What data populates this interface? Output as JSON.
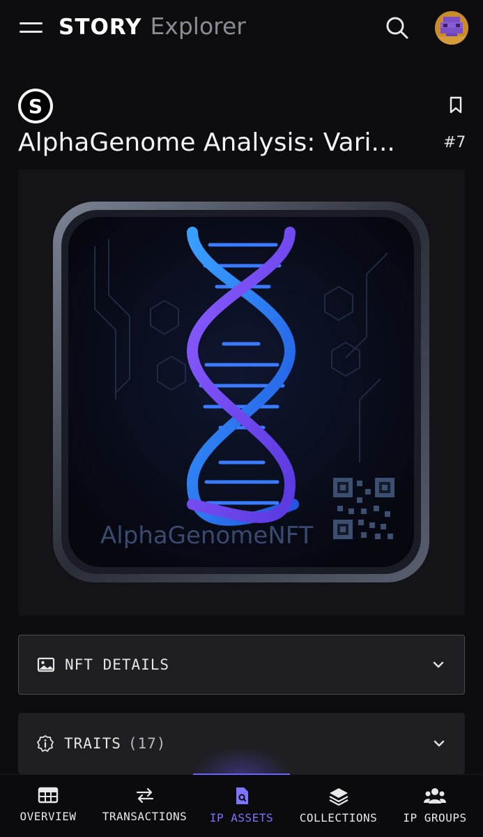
{
  "header": {
    "brand_story": "STORY",
    "brand_explorer": "Explorer",
    "menu_icon": "hamburger-menu-icon",
    "search_icon": "search-icon",
    "avatar_icon": "pixel-avatar"
  },
  "asset": {
    "title": "AlphaGenome Analysis: Vari...",
    "token_id": "#7",
    "creator_logo_letter": "S",
    "bookmark_icon": "bookmark-icon"
  },
  "artwork": {
    "caption": "AlphaGenomeNFT"
  },
  "accordions": {
    "nft_details": {
      "label": "NFT DETAILS",
      "icon": "image-icon"
    },
    "traits": {
      "label": "TRAITS",
      "count": "(17)",
      "icon": "info-badge-icon"
    }
  },
  "bottom_nav": {
    "items": [
      {
        "label": "OVERVIEW",
        "icon": "table-icon",
        "active": false
      },
      {
        "label": "TRANSACTIONS",
        "icon": "swap-arrows-icon",
        "active": false
      },
      {
        "label": "IP ASSETS",
        "icon": "document-search-icon",
        "active": true
      },
      {
        "label": "COLLECTIONS",
        "icon": "layers-icon",
        "active": false
      },
      {
        "label": "IP GROUPS",
        "icon": "users-group-icon",
        "active": false
      }
    ]
  },
  "colors": {
    "background": "#0d0d0f",
    "panel": "#1f1f23",
    "accent": "#7d74ff",
    "text": "#f2f2f2"
  }
}
